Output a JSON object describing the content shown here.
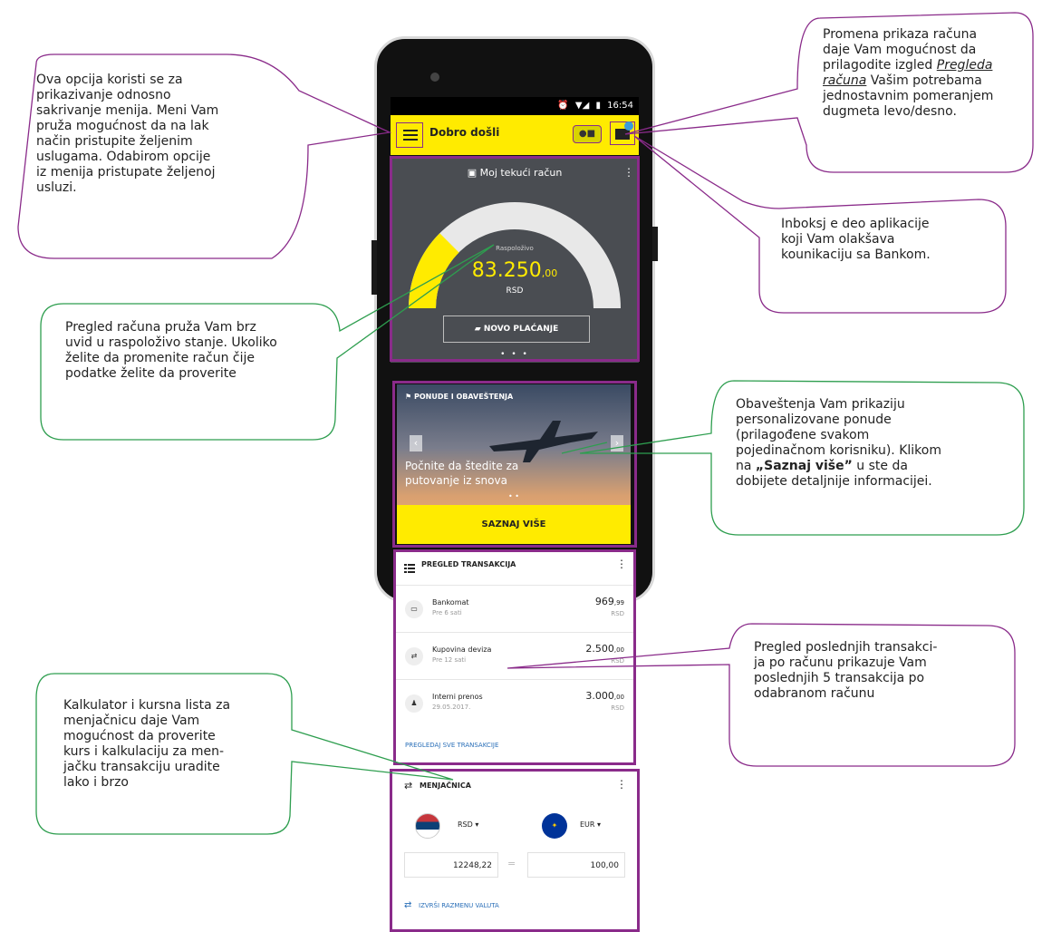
{
  "annotations": {
    "menu": [
      "Ova opcija koristi se za",
      "prikazivanje odnosno",
      "sakrivanje menija. Meni Vam",
      "pruža mogućnost da na lak",
      "način pristupite željenim",
      "uslugama. Odabirom opcije",
      "iz menija pristupate željenoj",
      "usluzi."
    ],
    "view": {
      "line1": "Promena prikaza računa",
      "line2": "daje Vam mogućnost da",
      "line3_pre": "prilagodite izgled ",
      "line3_link": "Pregleda",
      "line4_link": "računa",
      "line4_post": " Vašim potrebama",
      "line5": "jednostavnim pomeranjem",
      "line6": "dugmeta levo/desno."
    },
    "inbox": [
      "Inboksj e deo aplikacije",
      "koji Vam olakšava",
      "kounikaciju sa Bankom."
    ],
    "account": [
      "Pregled računa pruža Vam brz",
      "uvid u raspoloživo stanje. Ukoliko",
      "želite da promenite račun čije",
      "podatke želite da proverite"
    ],
    "offers": {
      "lines": [
        "Obaveštenja Vam prikaziju",
        "personalizovane ponude",
        "(prilagođene svakom",
        "pojedinačnom korisniku). Klikom"
      ],
      "line5_pre": "na ",
      "line5_bold": "„Saznaj više”",
      "line5_post": " u ste da",
      "line6": "dobijete detaljnije informacijei."
    },
    "transactions": [
      "Pregled poslednjih transakci-",
      "ja po računu prikazuje Vam",
      "poslednjih 5 transakcija po",
      "odabranom računu"
    ],
    "exchange": [
      "Kalkulator i kursna lista za",
      "menjačnicu daje Vam",
      "mogućnost da proverite",
      "kurs i kalkulaciju za men-",
      "jačku transakciju uradite",
      "lako i brzo"
    ]
  },
  "phone": {
    "status_time": "16:54",
    "greeting": "Dobro došli",
    "view_toggle_icon": "toggle-icon",
    "account": {
      "title": "Moj tekući račun",
      "available_label": "Raspoloživo",
      "balance_main": "83.250",
      "balance_decimal": ",00",
      "currency": "RSD",
      "gauge_fill_fraction": 0.25,
      "new_payment": "NOVO PLAĆANJE",
      "dots": "• • •"
    },
    "offers": {
      "title": "PONUDE I OBAVEŠTENJA",
      "text_line1": "Počnite da štedite za",
      "text_line2": "putovanje iz snova",
      "dots": "• •",
      "cta": "SAZNAJ VIŠE"
    },
    "transactions": {
      "title": "PREGLED TRANSAKCIJA",
      "items": [
        {
          "icon": "atm-icon",
          "name": "Bankomat",
          "time": "Pre 6 sati",
          "amount": "969",
          "decimal": ",99",
          "currency": "RSD"
        },
        {
          "icon": "exchange-icon",
          "name": "Kupovina deviza",
          "time": "Pre 12 sati",
          "amount": "2.500",
          "decimal": ",00",
          "currency": "RSD"
        },
        {
          "icon": "person-icon",
          "name": "Interni prenos",
          "time": "29.05.2017.",
          "amount": "3.000",
          "decimal": ",00",
          "currency": "RSD"
        }
      ],
      "see_all": "PREGLEDAJ SVE TRANSAKCIJE"
    },
    "exchange": {
      "title": "MENJAČNICA",
      "from_currency": "RSD ▾",
      "to_currency": "EUR ▾",
      "from_amount": "12248,22",
      "equals": "=",
      "to_amount": "100,00",
      "action": "IZVRŠI RAZMENU VALUTA"
    }
  },
  "colors": {
    "brand_yellow": "#ffeb00",
    "highlight_purple": "#8a2b8a",
    "callout_green": "#2e9e4f"
  }
}
